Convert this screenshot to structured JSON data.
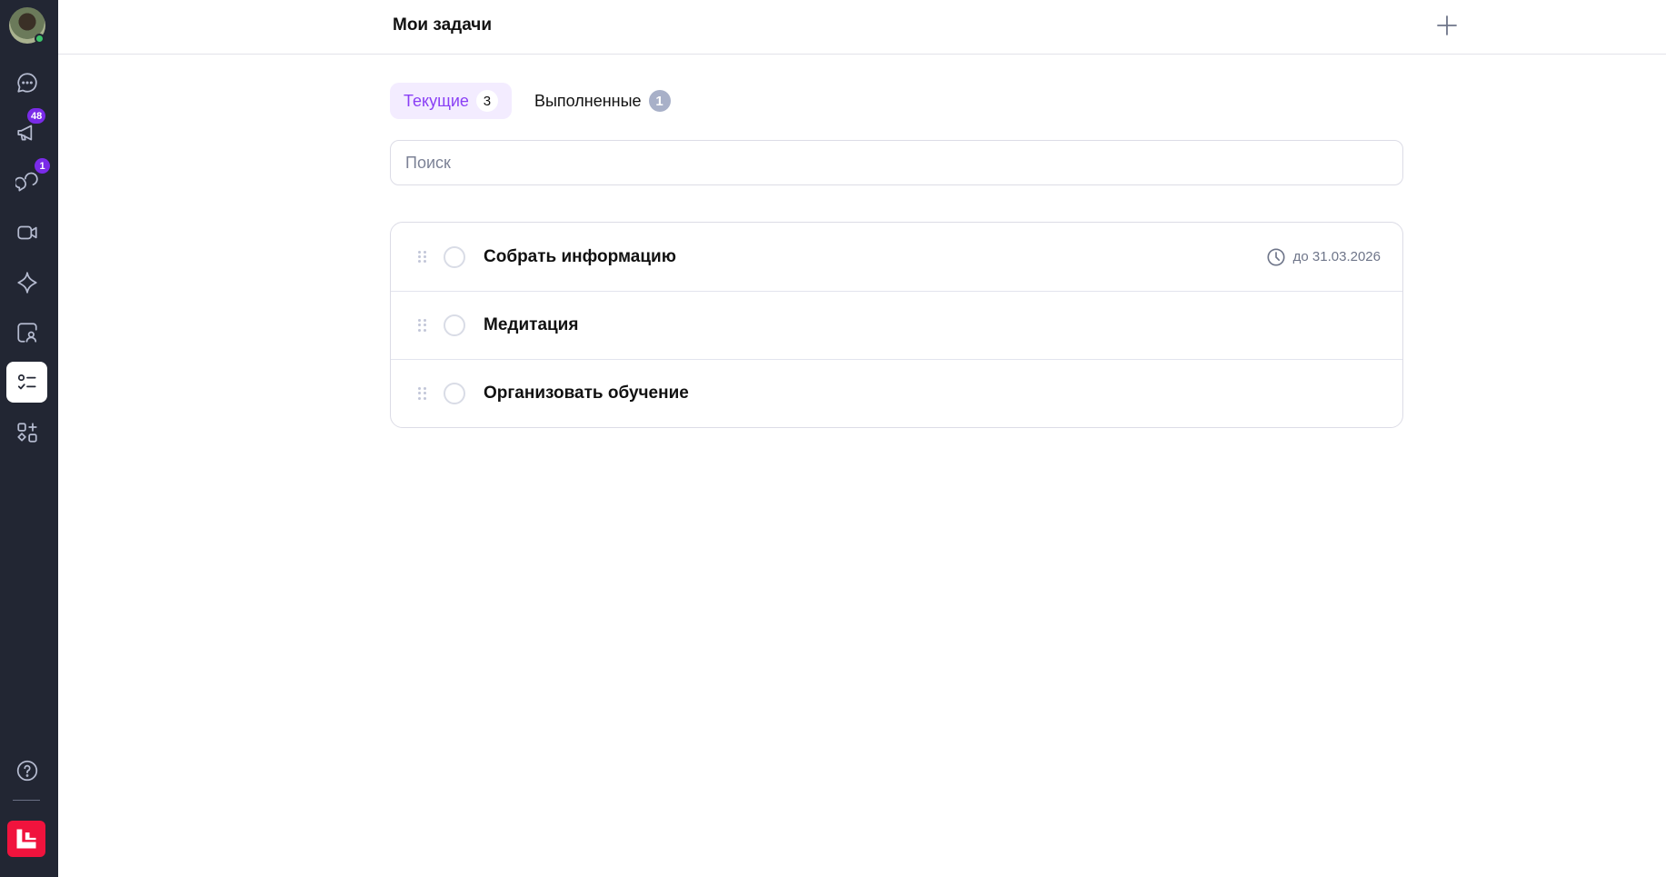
{
  "sidebar": {
    "items": [
      {
        "id": "chats",
        "icon": "chat-bubble-icon"
      },
      {
        "id": "announcements",
        "icon": "megaphone-icon",
        "badge": "48"
      },
      {
        "id": "discussions",
        "icon": "discussion-icon",
        "badge": "1"
      },
      {
        "id": "video",
        "icon": "video-camera-icon"
      },
      {
        "id": "ai",
        "icon": "sparkle-icon"
      },
      {
        "id": "contacts",
        "icon": "contact-card-icon"
      },
      {
        "id": "tasks",
        "icon": "task-list-icon",
        "active": true
      },
      {
        "id": "apps",
        "icon": "apps-icon"
      },
      {
        "id": "help",
        "icon": "help-icon"
      }
    ],
    "online_color": "#3cc46b",
    "logo_color": "#f0133d"
  },
  "header": {
    "title": "Мои задачи",
    "add_icon": "plus-icon"
  },
  "tabs": [
    {
      "label": "Текущие",
      "count": "3",
      "active": true
    },
    {
      "label": "Выполненные",
      "count": "1",
      "active": false
    }
  ],
  "search": {
    "placeholder": "Поиск",
    "value": ""
  },
  "tasks": [
    {
      "title": "Собрать информацию",
      "due": "до 31.03.2026"
    },
    {
      "title": "Медитация"
    },
    {
      "title": "Организовать обучение"
    }
  ],
  "colors": {
    "accent": "#8a3ff5",
    "sidebar_bg": "#222633",
    "badge": "#7a2be8"
  }
}
